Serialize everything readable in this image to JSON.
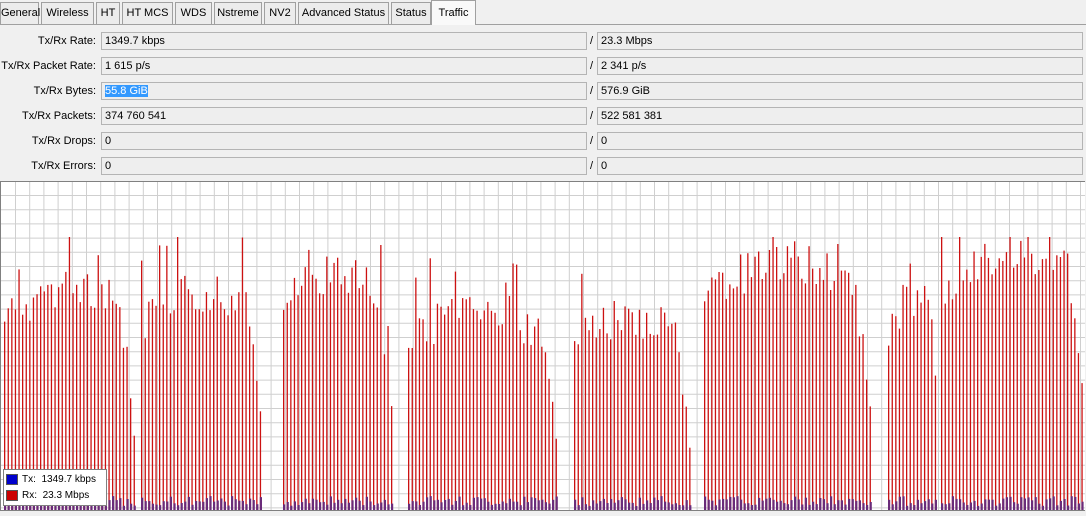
{
  "tabs": [
    {
      "id": "general",
      "label": "General"
    },
    {
      "id": "wireless",
      "label": "Wireless"
    },
    {
      "id": "ht",
      "label": "HT"
    },
    {
      "id": "htmcs",
      "label": "HT MCS"
    },
    {
      "id": "wds",
      "label": "WDS"
    },
    {
      "id": "nstreme",
      "label": "Nstreme"
    },
    {
      "id": "nv2",
      "label": "NV2"
    },
    {
      "id": "advanced",
      "label": "Advanced Status"
    },
    {
      "id": "status",
      "label": "Status"
    },
    {
      "id": "traffic",
      "label": "Traffic",
      "active": true
    }
  ],
  "rows": [
    {
      "id": "rate",
      "label": "Tx/Rx Rate:",
      "tx": "1349.7 kbps",
      "rx": "23.3 Mbps"
    },
    {
      "id": "packet-rate",
      "label": "Tx/Rx Packet Rate:",
      "tx": "1 615 p/s",
      "rx": "2 341 p/s"
    },
    {
      "id": "bytes",
      "label": "Tx/Rx Bytes:",
      "tx": "55.8 GiB",
      "rx": "576.9 GiB",
      "tx_selected": true
    },
    {
      "id": "packets",
      "label": "Tx/Rx Packets:",
      "tx": "374 760 541",
      "rx": "522 581 381"
    },
    {
      "id": "drops",
      "label": "Tx/Rx Drops:",
      "tx": "0",
      "rx": "0"
    },
    {
      "id": "errors",
      "label": "Tx/Rx Errors:",
      "tx": "0",
      "rx": "0"
    }
  ],
  "separator": "/",
  "legend": {
    "tx": {
      "label": "Tx:",
      "value": "1349.7 kbps",
      "color": "#0000cc"
    },
    "rx": {
      "label": "Rx:",
      "value": "23.3 Mbps",
      "color": "#cc0000"
    }
  },
  "colors": {
    "grid": "#cfcfcf",
    "rx_bar": "#cc1111",
    "tx_bar": "#6a2c7a",
    "selection": "#3399ff"
  }
}
